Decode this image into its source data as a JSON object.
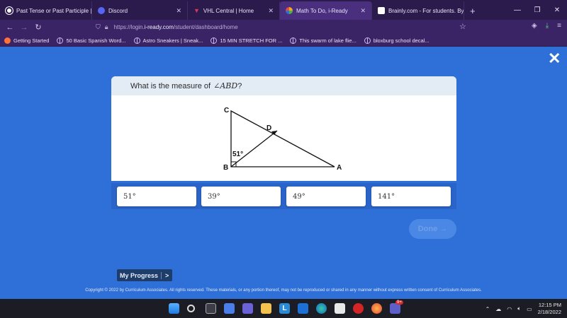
{
  "browser": {
    "tabs": [
      {
        "title": "Past Tense or Past Participle | Sc",
        "active": false
      },
      {
        "title": "Discord",
        "active": false
      },
      {
        "title": "VHL Central | Home",
        "active": false
      },
      {
        "title": "Math To Do, i-Ready",
        "active": true
      },
      {
        "title": "Brainly.com - For students. By s",
        "active": false
      }
    ],
    "url_prefix": "https://login.",
    "url_domain": "i-ready.com",
    "url_path": "/student/dashboard/home",
    "bookmarks": [
      "Getting Started",
      "50 Basic Spanish Word...",
      "Astro Sneakers | Sneak...",
      "15 MIN STRETCH FOR ...",
      "This swarm of lake flie...",
      "bloxburg school decal..."
    ]
  },
  "question": {
    "prefix": "What is the measure of ",
    "angle": "∠ABD",
    "suffix": "?"
  },
  "figure": {
    "labels": {
      "C": "C",
      "D": "D",
      "B": "B",
      "A": "A"
    },
    "angle_label": "51°"
  },
  "answers": [
    "51°",
    "39°",
    "49°",
    "141°"
  ],
  "done_label": "Done →",
  "progress_label": "My Progress",
  "progress_arrow": ">",
  "copyright": "Copyright © 2022 by Curriculum Associates. All rights reserved. These materials, or any portion thereof, may not be reproduced or shared in any manner without express written consent of Curriculum Associates.",
  "taskbar": {
    "time": "12:15 PM",
    "date": "2/18/2022",
    "teams_badge": "9+"
  }
}
